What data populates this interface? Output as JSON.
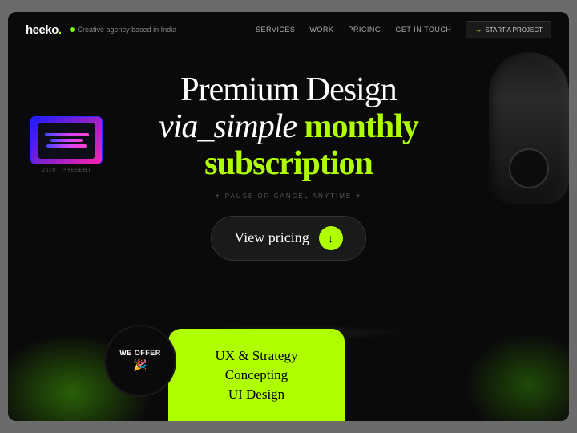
{
  "nav": {
    "logo": "heeko",
    "logo_dot": ".",
    "tagline": "Creative agency based in India",
    "links": [
      "SERVICES",
      "WORK",
      "PRICING",
      "GET IN TOUCH"
    ],
    "cta_arrow": "→",
    "cta_label": "START A PROJECT"
  },
  "hero": {
    "line1": "Premium Design",
    "line2_italic": "via_simple",
    "line2_green": "monthly",
    "line3": "subscription",
    "subtitle": "✦ PAUSE OR CANCEL ANYTIME ✦",
    "cta_button": "View pricing",
    "cta_arrow": "↓"
  },
  "thumbnail": {
    "label": "2019 · PRESENT"
  },
  "offer": {
    "badge_line1": "WE OFFER",
    "badge_emoji": "🎉",
    "card_items": [
      "UX & Strategy",
      "Concepting",
      "UI Design"
    ]
  },
  "colors": {
    "green": "#b0ff00",
    "dark": "#0a0a0a",
    "nav_bg": "#111"
  }
}
